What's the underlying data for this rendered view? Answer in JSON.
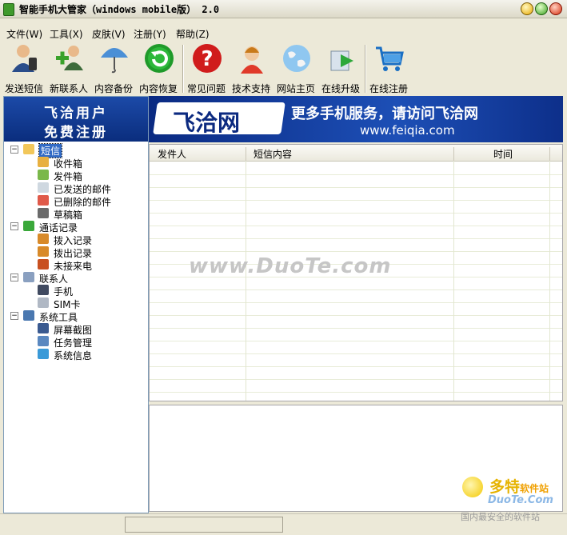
{
  "window": {
    "title": "智能手机大管家（windows mobile版） 2.0"
  },
  "menu": [
    {
      "label": "文件(W)"
    },
    {
      "label": "工具(X)"
    },
    {
      "label": "皮肤(V)"
    },
    {
      "label": "注册(Y)"
    },
    {
      "label": "帮助(Z)"
    }
  ],
  "toolbar": [
    {
      "label": "发送短信",
      "icon": "user-sms-icon"
    },
    {
      "label": "新联系人",
      "icon": "add-contact-icon"
    },
    {
      "label": "内容备份",
      "icon": "umbrella-icon"
    },
    {
      "label": "内容恢复",
      "icon": "restore-icon"
    },
    {
      "label": "常见问题",
      "icon": "question-icon"
    },
    {
      "label": "技术支持",
      "icon": "support-icon"
    },
    {
      "label": "网站主页",
      "icon": "globe-icon"
    },
    {
      "label": "在线升级",
      "icon": "upgrade-icon"
    },
    {
      "label": "在线注册",
      "icon": "cart-icon"
    }
  ],
  "promo": {
    "line1": "飞洽用户",
    "line2": "免费注册"
  },
  "banner": {
    "logo": "飞洽网",
    "slogan": "更多手机服务，请访问飞洽网",
    "url": "www.feiqia.com"
  },
  "tree": [
    {
      "label": "短信",
      "level": 0,
      "expanded": true,
      "selected": true,
      "icon": "folder-icon"
    },
    {
      "label": "收件箱",
      "level": 1,
      "icon": "inbox-icon"
    },
    {
      "label": "发件箱",
      "level": 1,
      "icon": "outbox-icon"
    },
    {
      "label": "已发送的邮件",
      "level": 1,
      "icon": "sent-mail-icon"
    },
    {
      "label": "已删除的邮件",
      "level": 1,
      "icon": "deleted-mail-icon"
    },
    {
      "label": "草稿箱",
      "level": 1,
      "icon": "drafts-icon"
    },
    {
      "label": "通话记录",
      "level": 0,
      "expanded": true,
      "icon": "call-log-icon"
    },
    {
      "label": "拨入记录",
      "level": 1,
      "icon": "incoming-call-icon"
    },
    {
      "label": "拨出记录",
      "level": 1,
      "icon": "outgoing-call-icon"
    },
    {
      "label": "未接来电",
      "level": 1,
      "icon": "missed-call-icon"
    },
    {
      "label": "联系人",
      "level": 0,
      "expanded": true,
      "icon": "contacts-icon"
    },
    {
      "label": "手机",
      "level": 1,
      "icon": "phone-icon"
    },
    {
      "label": "SIM卡",
      "level": 1,
      "icon": "sim-card-icon"
    },
    {
      "label": "系统工具",
      "level": 0,
      "expanded": true,
      "icon": "tools-icon"
    },
    {
      "label": "屏幕截图",
      "level": 1,
      "icon": "screenshot-icon"
    },
    {
      "label": "任务管理",
      "level": 1,
      "icon": "task-manager-icon"
    },
    {
      "label": "系统信息",
      "level": 1,
      "icon": "system-info-icon"
    }
  ],
  "grid": {
    "columns": [
      "发件人",
      "短信内容",
      "时间"
    ]
  },
  "watermark": "www.DuoTe.com",
  "corner": {
    "brand": "多特",
    "brand_small": "软件站",
    "site": "DuoTe.Com",
    "tagline": "国内最安全的软件站"
  }
}
